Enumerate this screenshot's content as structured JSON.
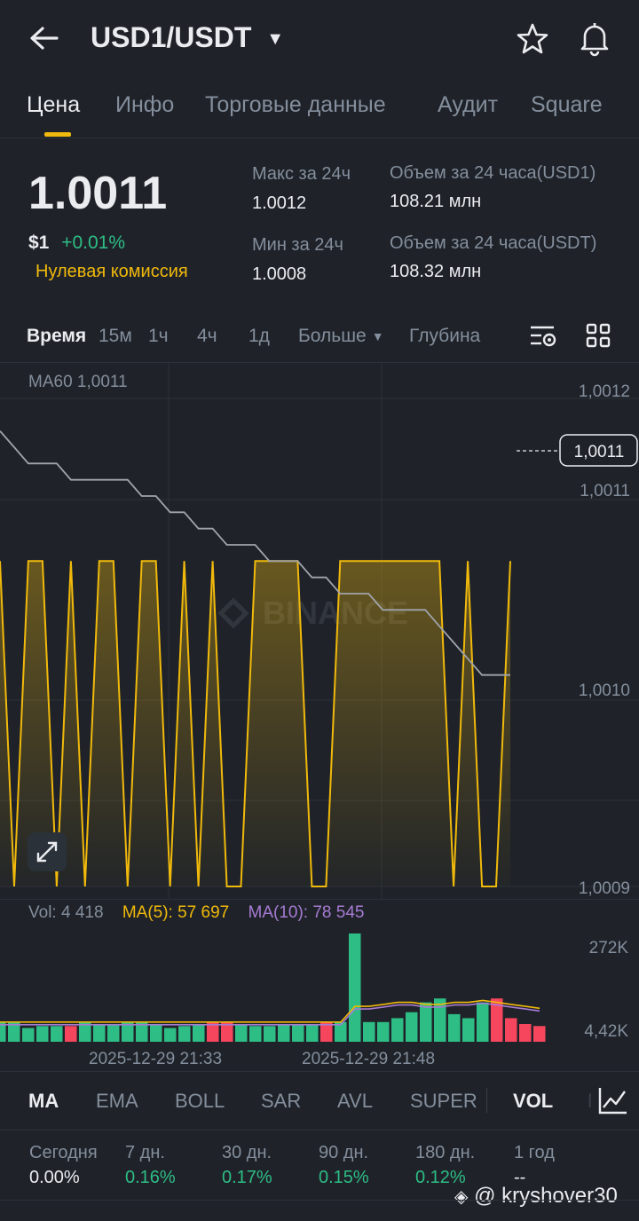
{
  "header": {
    "pair": "USD1/USDT"
  },
  "tabs": [
    "Цена",
    "Инфо",
    "Торговые данные",
    "Аудит",
    "Square"
  ],
  "price": {
    "last": "1.0011",
    "usd": "$1",
    "change": "+0.01%",
    "promo": "Нулевая комиссия",
    "high_label": "Макс за 24ч",
    "high": "1.0012",
    "low_label": "Мин за 24ч",
    "low": "1.0008",
    "vol_base_label": "Объем за 24 часа(USD1)",
    "vol_base": "108.21 млн",
    "vol_quote_label": "Объем за 24 часа(USDT)",
    "vol_quote": "108.32 млн"
  },
  "timeframes": {
    "time": "Время",
    "m15": "15м",
    "h1": "1ч",
    "h4": "4ч",
    "d1": "1д",
    "more": "Больше",
    "depth": "Глубина"
  },
  "chart": {
    "ma_label": "MA60 1,0011",
    "price_axis": [
      "1,0012",
      "1,0011",
      "1,0010",
      "1,0009"
    ],
    "current_price_tag": "1,0011",
    "watermark": "BINANCE",
    "vol_label": "Vol: 4 418",
    "ma5_label": "MA(5): 57 697",
    "ma10_label": "MA(10): 78 545",
    "vol_axis": [
      "272K",
      "4,42K"
    ],
    "time_labels": [
      "2025-12-29 21:33",
      "2025-12-29 21:48"
    ],
    "colors": {
      "line": "#f0b90b",
      "up": "#2ebd85",
      "down": "#f6465d",
      "ma60": "#a0a4ab",
      "ma10": "#a77bd4"
    }
  },
  "chart_data": {
    "type": "line",
    "y_unit": "price",
    "ylim": [
      1.0009,
      1.0012
    ],
    "price_series": [
      1.0011,
      1.0009,
      1.0011,
      1.0011,
      1.0009,
      1.0011,
      1.0009,
      1.0011,
      1.0011,
      1.0009,
      1.0011,
      1.0011,
      1.0009,
      1.0011,
      1.0009,
      1.0011,
      1.0009,
      1.0009,
      1.0011,
      1.0011,
      1.0011,
      1.0011,
      1.0009,
      1.0009,
      1.0011,
      1.0011,
      1.0011,
      1.0011,
      1.0011,
      1.0011,
      1.0011,
      1.0011,
      1.0009,
      1.0011,
      1.0009,
      1.0009,
      1.0011
    ],
    "ma60": [
      1.00118,
      1.00117,
      1.00116,
      1.00116,
      1.00116,
      1.00115,
      1.00115,
      1.00115,
      1.00115,
      1.00115,
      1.00114,
      1.00114,
      1.00113,
      1.00113,
      1.00112,
      1.00112,
      1.00111,
      1.00111,
      1.00111,
      1.0011,
      1.0011,
      1.0011,
      1.00109,
      1.00109,
      1.00108,
      1.00108,
      1.00108,
      1.00107,
      1.00107,
      1.00107,
      1.00107,
      1.00106,
      1.00105,
      1.00104,
      1.00103,
      1.00103,
      1.00103
    ],
    "volume": [
      10,
      10,
      7,
      8,
      8,
      8,
      10,
      9,
      9,
      10,
      10,
      9,
      7,
      8,
      9,
      10,
      10,
      9,
      8,
      8,
      9,
      9,
      9,
      10,
      10,
      55,
      10,
      10,
      12,
      15,
      20,
      22,
      14,
      12,
      20,
      22,
      12,
      9,
      8
    ],
    "volume_up": [
      true,
      true,
      true,
      true,
      true,
      false,
      true,
      true,
      true,
      true,
      true,
      true,
      true,
      true,
      true,
      false,
      false,
      true,
      true,
      true,
      true,
      true,
      true,
      false,
      true,
      true,
      true,
      true,
      true,
      true,
      true,
      true,
      true,
      true,
      true,
      false,
      false,
      false,
      false
    ],
    "vol_ma": [
      10,
      10,
      10,
      10,
      10,
      10,
      10,
      10,
      10,
      10,
      10,
      10,
      10,
      10,
      10,
      10,
      10,
      10,
      10,
      10,
      10,
      10,
      10,
      10,
      10,
      18,
      18,
      19,
      20,
      20,
      19,
      19,
      20,
      20,
      21,
      20,
      19,
      18,
      17
    ]
  },
  "indicators": [
    "MA",
    "EMA",
    "BOLL",
    "SAR",
    "AVL",
    "SUPER",
    "VOL",
    "M"
  ],
  "performance": [
    {
      "label": "Сегодня",
      "value": "0.00%"
    },
    {
      "label": "7 дн.",
      "value": "0.16%"
    },
    {
      "label": "30 дн.",
      "value": "0.17%"
    },
    {
      "label": "90 дн.",
      "value": "0.15%"
    },
    {
      "label": "180 дн.",
      "value": "0.12%"
    },
    {
      "label": "1 год",
      "value": "--"
    }
  ],
  "watermark_user": "@ kryshover30"
}
